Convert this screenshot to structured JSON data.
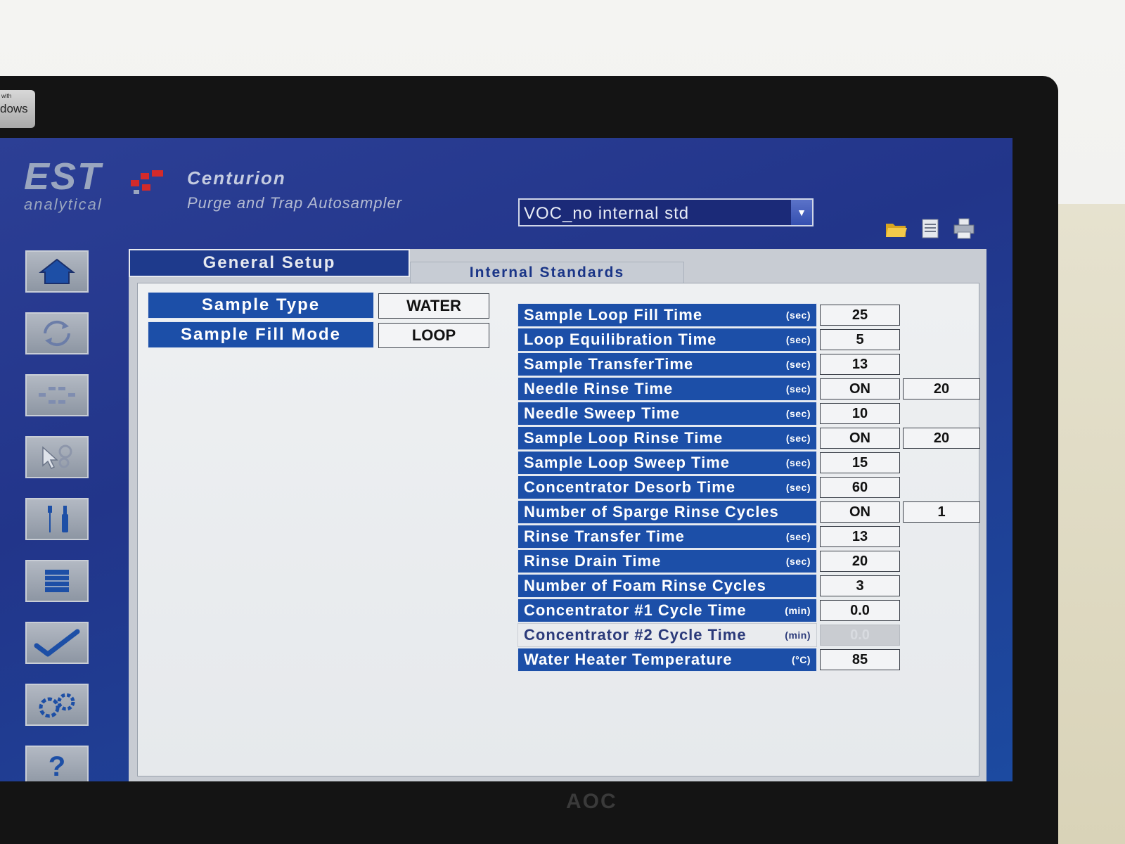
{
  "badge": {
    "line1": "with",
    "line2": "dows"
  },
  "monitor_brand": "AOC",
  "header": {
    "logo_text": "EST",
    "logo_sub": "analytical",
    "app_title": "Centurion",
    "app_subtitle": "Purge and Trap Autosampler",
    "method_value": "VOC_no internal std"
  },
  "colors": {
    "accent": "#1c4fa8",
    "header_bg": "#22358a",
    "logo_red": "#d42a2a"
  },
  "toolbar_icons": [
    "folder-open-icon",
    "document-icon",
    "printer-icon"
  ],
  "sidebar": [
    "home-icon",
    "refresh-cycle-icon",
    "sequence-icon",
    "cursor-select-icon",
    "tools-icon",
    "list-icon",
    "checkmark-icon",
    "gears-icon",
    "help-icon"
  ],
  "sidebar_help_glyph": "?",
  "tabs": {
    "general": "General Setup",
    "internal": "Internal Standards"
  },
  "left": {
    "sample_type_label": "Sample Type",
    "sample_type_value": "WATER",
    "fill_mode_label": "Sample Fill Mode",
    "fill_mode_value": "LOOP"
  },
  "params": [
    {
      "label": "Sample Loop Fill Time",
      "unit": "(sec)",
      "value": "25",
      "value2": ""
    },
    {
      "label": "Loop Equilibration Time",
      "unit": "(sec)",
      "value": "5",
      "value2": ""
    },
    {
      "label": "Sample TransferTime",
      "unit": "(sec)",
      "value": "13",
      "value2": ""
    },
    {
      "label": "Needle Rinse Time",
      "unit": "(sec)",
      "value": "ON",
      "value2": "20"
    },
    {
      "label": "Needle Sweep Time",
      "unit": "(sec)",
      "value": "10",
      "value2": ""
    },
    {
      "label": "Sample Loop Rinse Time",
      "unit": "(sec)",
      "value": "ON",
      "value2": "20"
    },
    {
      "label": "Sample Loop Sweep Time",
      "unit": "(sec)",
      "value": "15",
      "value2": ""
    },
    {
      "label": "Concentrator Desorb Time",
      "unit": "(sec)",
      "value": "60",
      "value2": ""
    },
    {
      "label": "Number of Sparge Rinse Cycles",
      "unit": "",
      "value": "ON",
      "value2": "1"
    },
    {
      "label": "Rinse Transfer Time",
      "unit": "(sec)",
      "value": "13",
      "value2": ""
    },
    {
      "label": "Rinse Drain Time",
      "unit": "(sec)",
      "value": "20",
      "value2": ""
    },
    {
      "label": "Number of Foam Rinse Cycles",
      "unit": "",
      "value": "3",
      "value2": ""
    },
    {
      "label": "Concentrator #1 Cycle Time",
      "unit": "(min)",
      "value": "0.0",
      "value2": ""
    },
    {
      "label": "Concentrator #2 Cycle Time",
      "unit": "(min)",
      "value": "0.0",
      "value2": "",
      "disabled": true
    },
    {
      "label": "Water Heater Temperature",
      "unit": "(°C)",
      "value": "85",
      "value2": ""
    }
  ]
}
